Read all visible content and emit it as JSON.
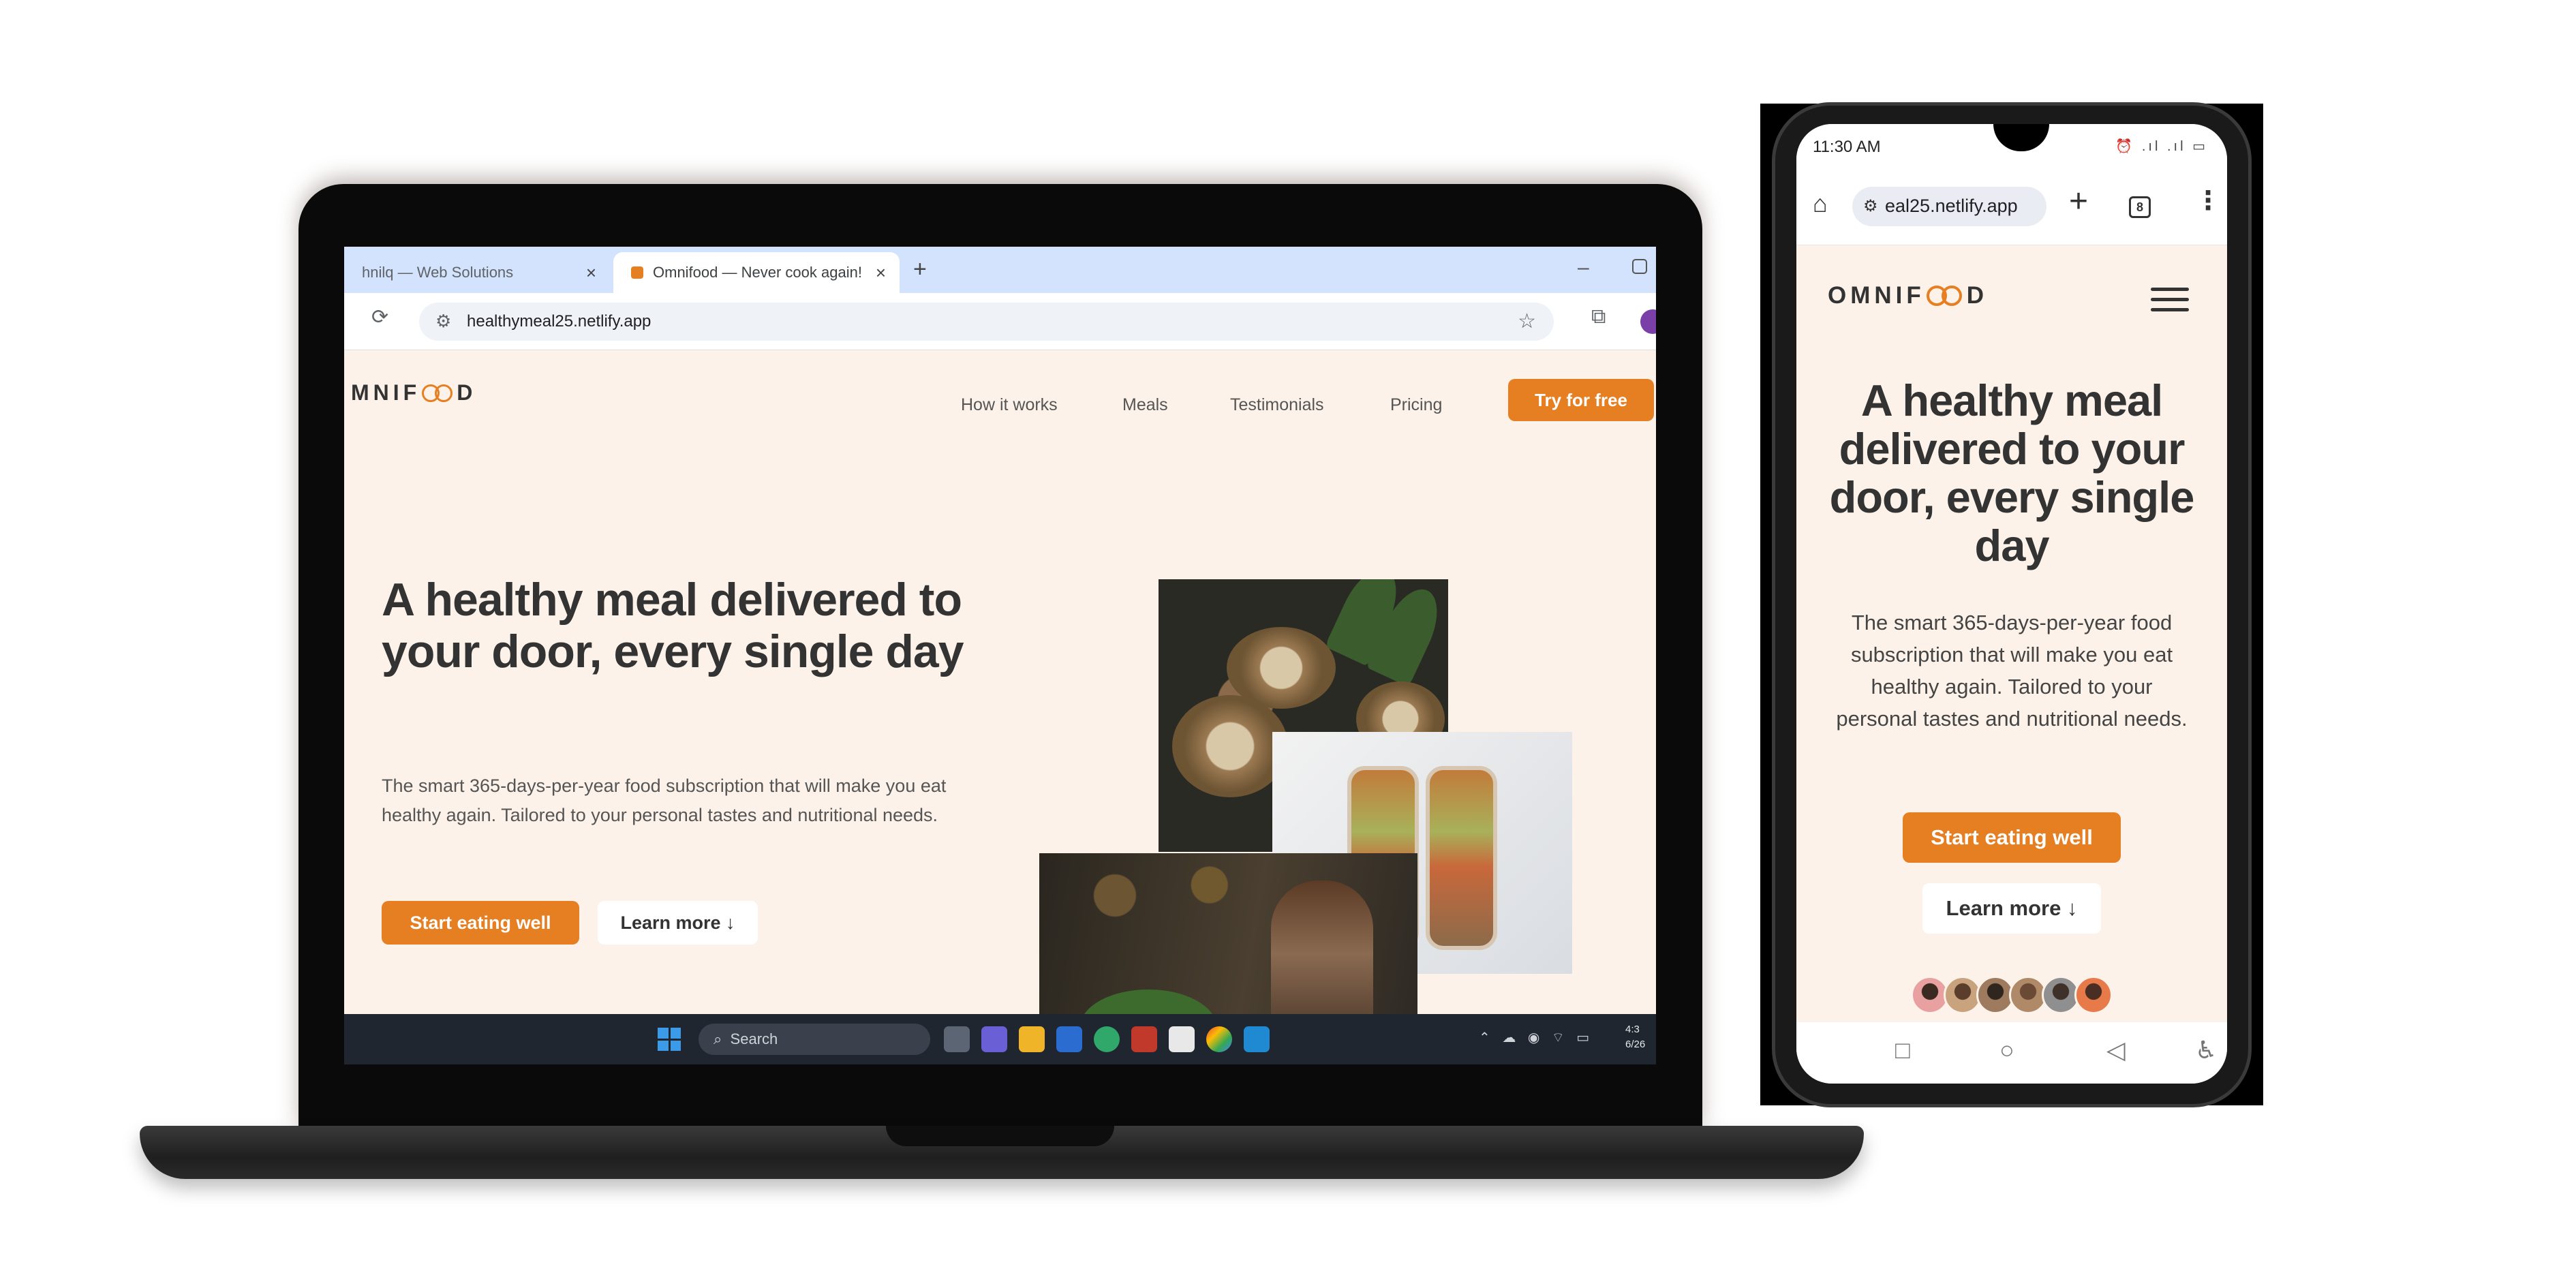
{
  "laptop": {
    "tabs": [
      {
        "label": "hnilq — Web Solutions",
        "active": false
      },
      {
        "label": "Omnifood — Never cook again!",
        "active": true
      }
    ],
    "new_tab_symbol": "+",
    "address": "healthymeal25.netlify.app",
    "site": {
      "logo_left": "MNIF",
      "logo_right": "D",
      "nav": [
        "How it works",
        "Meals",
        "Testimonials",
        "Pricing"
      ],
      "cta": "Try for free",
      "hero_title": "A healthy meal delivered to your door, every single day",
      "hero_desc": "The smart 365-days-per-year food subscription that will make you eat healthy again. Tailored to your personal tastes and nutritional needs.",
      "btn_primary": "Start eating well",
      "btn_secondary": "Learn more ↓"
    },
    "taskbar": {
      "search_placeholder": "Search",
      "time_line1": "4:3",
      "time_line2": "6/26"
    }
  },
  "phone": {
    "status_time": "11:30 AM",
    "status_icons": "⏰ .ıl .ıl ▭",
    "address": "eal25.netlify.app",
    "tab_count": "8",
    "site": {
      "logo_left": "OMNIF",
      "logo_right": "D",
      "hero_title": "A healthy meal delivered to your door, every single day",
      "hero_desc": "The smart 365-days-per-year food subscription that will make you eat healthy again. Tailored to your personal tastes and nutritional needs.",
      "btn_primary": "Start eating well",
      "btn_secondary": "Learn more ↓"
    }
  },
  "colors": {
    "brand_orange": "#e67e22",
    "site_background": "#fdf2e9",
    "text_dark": "#333333"
  },
  "icons": [
    "home-icon",
    "tune-icon",
    "star-icon",
    "reload-icon",
    "menu-dots-icon",
    "hamburger-icon",
    "windows-start-icon",
    "search-icon"
  ]
}
